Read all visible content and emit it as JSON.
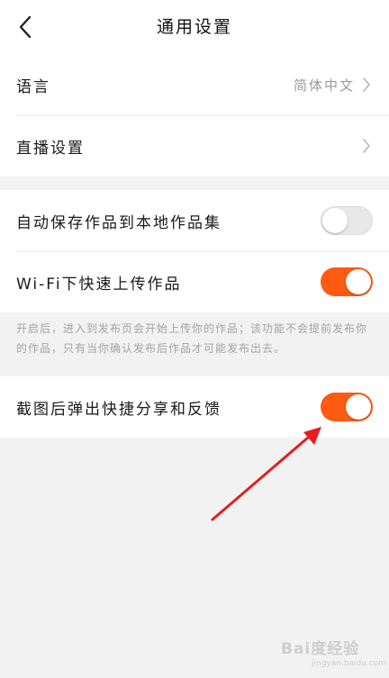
{
  "header": {
    "title": "通用设置",
    "back_icon": "chevron-left-icon"
  },
  "group1": {
    "rows": [
      {
        "label": "语言",
        "value": "简体中文"
      },
      {
        "label": "直播设置"
      }
    ]
  },
  "group2": {
    "rows": [
      {
        "label": "自动保存作品到本地作品集",
        "toggle": "off"
      },
      {
        "label": "Wi-Fi下快速上传作品",
        "toggle": "on"
      }
    ]
  },
  "note": "开启后，进入到发布页会开始上传你的作品；该功能不会提前发布你的作品，只有当你确认发布后作品才可能发布出去。",
  "group3": {
    "rows": [
      {
        "label": "截图后弹出快捷分享和反馈",
        "toggle": "on"
      }
    ]
  },
  "colors": {
    "accent": "#fe5a12",
    "annotation_arrow": "#e41e1e"
  },
  "watermark": {
    "text": "Bai度经验",
    "sub": "jingyan.baidu.com"
  }
}
